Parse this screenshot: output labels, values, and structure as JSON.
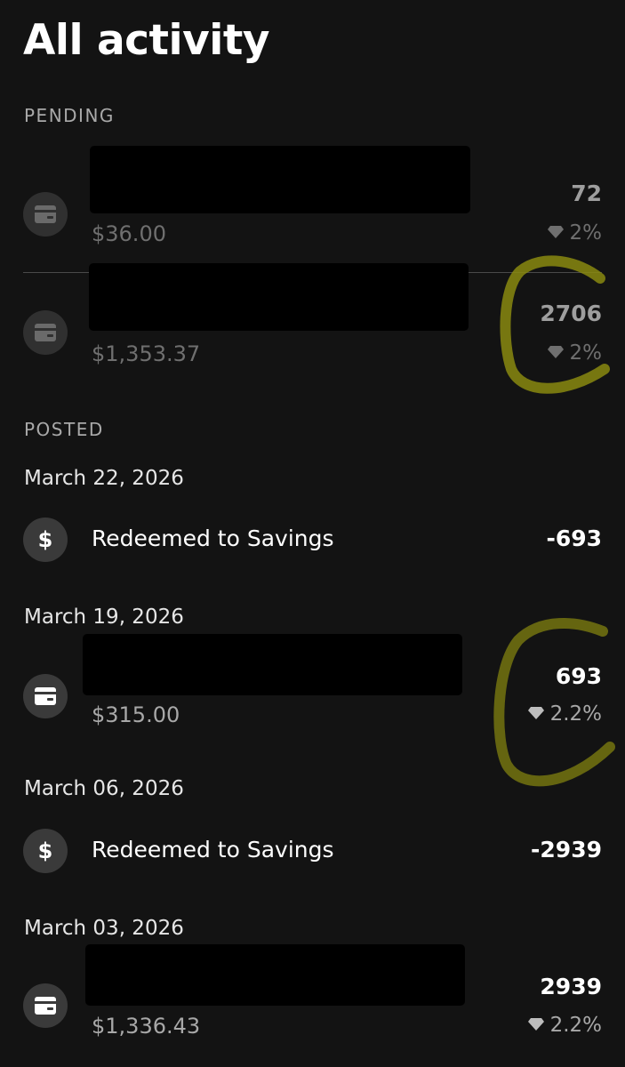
{
  "header": {
    "title": "All activity"
  },
  "pending": {
    "label": "PENDING",
    "items": [
      {
        "amount": "$36.00",
        "points": "72",
        "rate": "2%",
        "icon": "credit-card-icon"
      },
      {
        "amount": "$1,353.37",
        "points": "2706",
        "rate": "2%",
        "icon": "credit-card-icon"
      }
    ]
  },
  "posted": {
    "label": "POSTED",
    "groups": [
      {
        "date": "March 22, 2026",
        "description": "Redeemed to Savings",
        "points": "-693",
        "icon": "dollar-icon"
      },
      {
        "date": "March 19, 2026",
        "amount": "$315.00",
        "points": "693",
        "rate": "2.2%",
        "icon": "credit-card-icon"
      },
      {
        "date": "March 06, 2026",
        "description": "Redeemed to Savings",
        "points": "-2939",
        "icon": "dollar-icon"
      },
      {
        "date": "March 03, 2026",
        "amount": "$1,336.43",
        "points": "2939",
        "rate": "2.2%",
        "icon": "credit-card-icon"
      }
    ]
  },
  "icons": {
    "dollar_glyph": "$"
  },
  "colors": {
    "background": "#131313",
    "annotation": "#8a8a10",
    "pending_text": "#6f6f6f",
    "posted_text": "#a8a8a8"
  }
}
